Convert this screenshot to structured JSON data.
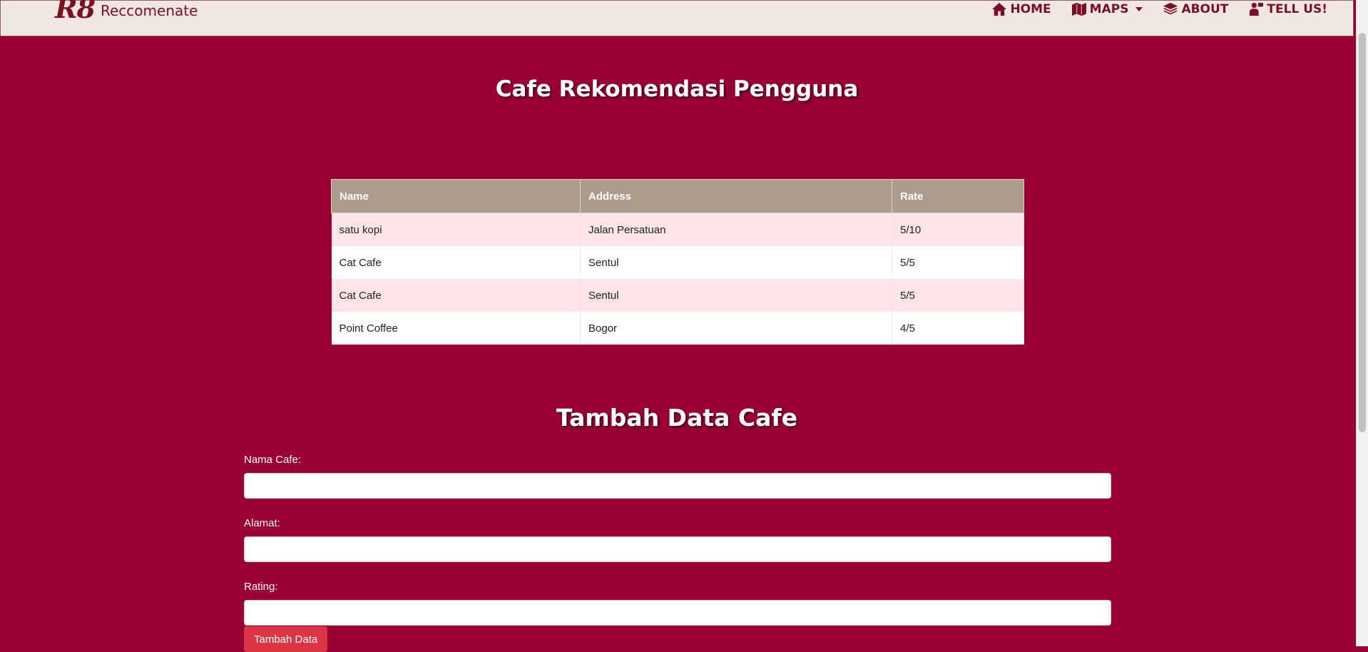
{
  "brand": {
    "mark": "R8",
    "name": "Reccomenate"
  },
  "nav": {
    "home": "HOME",
    "maps": "MAPS",
    "about": "ABOUT",
    "tell": "TELL US!"
  },
  "page_title": "Cafe Rekomendasi Pengguna",
  "table": {
    "headers": [
      "Name",
      "Address",
      "Rate"
    ],
    "rows": [
      [
        "satu kopi",
        "Jalan Persatuan",
        "5/10"
      ],
      [
        "Cat Cafe",
        "Sentul",
        "5/5"
      ],
      [
        "Cat Cafe",
        "Sentul",
        "5/5"
      ],
      [
        "Point Coffee",
        "Bogor",
        "4/5"
      ]
    ]
  },
  "form": {
    "title": "Tambah Data Cafe",
    "name_label": "Nama Cafe:",
    "address_label": "Alamat:",
    "rating_label": "Rating:",
    "name_value": "",
    "address_value": "",
    "rating_value": "",
    "submit_label": "Tambah Data"
  },
  "colors": {
    "background": "#990033",
    "navbar": "#f0e8e0",
    "brand": "#7a0f22",
    "table_header": "#ac9c8c",
    "row_stripe": "#fde4e8",
    "button": "#dc3545"
  },
  "icons": {
    "home": "home-icon",
    "maps": "map-icon",
    "about": "layers-icon",
    "tell": "user-message-icon"
  }
}
